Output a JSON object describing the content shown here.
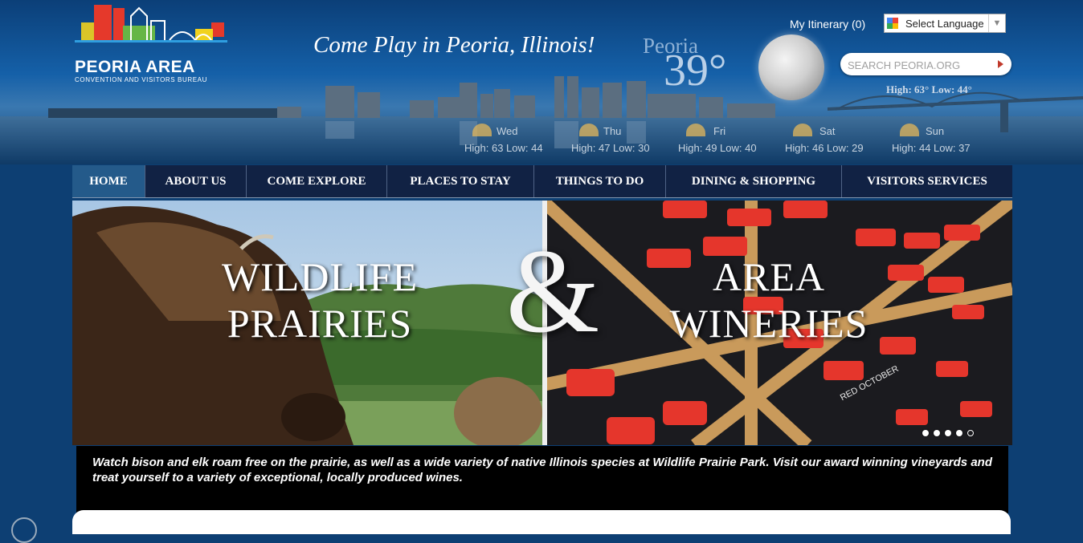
{
  "header": {
    "logo_name": "PEORIA AREA",
    "logo_subtitle": "CONVENTION AND VISITORS BUREAU",
    "tagline": "Come Play in Peoria, Illinois!",
    "itinerary_label": "My Itinerary (0)",
    "language_label": "Select Language",
    "search_placeholder": "SEARCH PEORIA.ORG"
  },
  "weather": {
    "city": "Peoria",
    "current_temp": "39°",
    "today_hilo": "High: 63° Low: 44°",
    "forecast": [
      {
        "day": "Wed",
        "hilo": "High: 63 Low: 44"
      },
      {
        "day": "Thu",
        "hilo": "High: 47 Low: 30"
      },
      {
        "day": "Fri",
        "hilo": "High: 49 Low: 40"
      },
      {
        "day": "Sat",
        "hilo": "High: 46 Low: 29"
      },
      {
        "day": "Sun",
        "hilo": "High: 44 Low: 37"
      }
    ]
  },
  "nav": {
    "items": [
      {
        "label": "HOME"
      },
      {
        "label": "ABOUT US"
      },
      {
        "label": "COME EXPLORE"
      },
      {
        "label": "PLACES TO STAY"
      },
      {
        "label": "THINGS TO DO"
      },
      {
        "label": "DINING & SHOPPING"
      },
      {
        "label": "VISITORS SERVICES"
      }
    ]
  },
  "hero": {
    "left_line1": "WILDLIFE",
    "left_line2": "PRAIRIES",
    "amp": "&",
    "right_line1": "AREA",
    "right_line2": "WINERIES",
    "bottle_label": "RED OCTOBER",
    "slide_count": 5,
    "current_slide": 5
  },
  "caption": {
    "text": "Watch bison and elk roam free on the prairie, as well as a wide variety of native Illinois species at Wildlife Prairie Park. Visit our award winning vineyards and treat yourself to a variety of exceptional, locally produced wines."
  },
  "colors": {
    "nav_bg": "#112244",
    "nav_active": "#245a8a",
    "page_bg": "#0d3f73",
    "search_arrow": "#c0392b"
  }
}
